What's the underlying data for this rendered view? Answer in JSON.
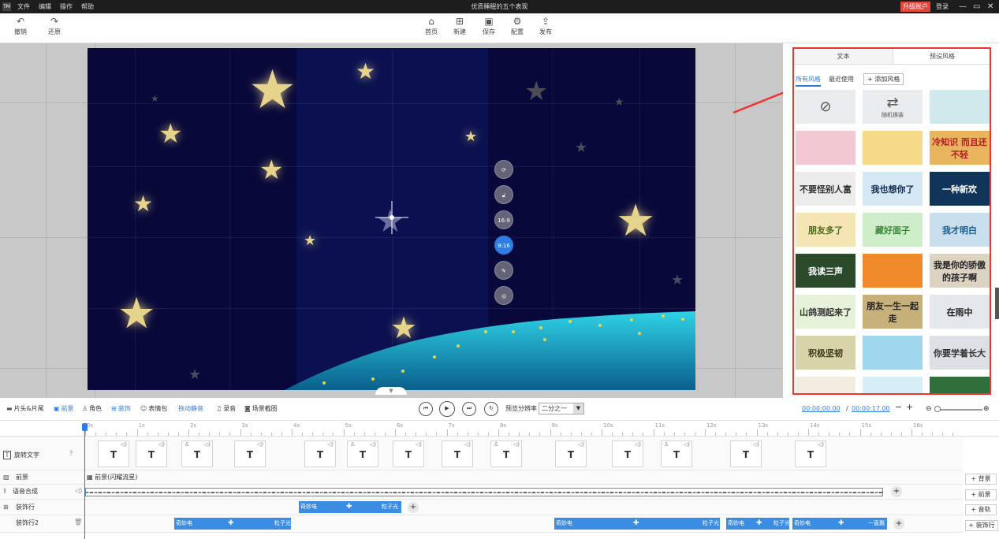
{
  "window": {
    "logo": "TM",
    "menu": [
      "文件",
      "编辑",
      "操作",
      "帮助"
    ],
    "title": "优质睡眠的五个表现",
    "upgrade": "升级账户",
    "login": "登录",
    "controls": [
      "—",
      "▭",
      "✕"
    ]
  },
  "toolbar": {
    "undo": "撤销",
    "redo": "还原",
    "home": "首页",
    "new": "新建",
    "save": "保存",
    "config": "配置",
    "publish": "发布"
  },
  "canvas_controls": [
    "16:9",
    "9:16"
  ],
  "panel": {
    "tabs": [
      "文本",
      "预设风格"
    ],
    "subtabs": [
      "所有风格",
      "最近使用"
    ],
    "add_style": "+ 添加风格",
    "random_label": "随机换装",
    "tiles": [
      {
        "text": "",
        "bg": "#e9ecef",
        "color": "#333"
      },
      {
        "text": "随机换装",
        "bg": "#e9ecef",
        "color": "#333"
      },
      {
        "text": "",
        "bg": "#cfe9ec",
        "color": "#333"
      },
      {
        "text": "",
        "bg": "#f2c9d3",
        "color": "#333"
      },
      {
        "text": "",
        "bg": "#f7d98a",
        "color": "#8a4a00"
      },
      {
        "text": "冷知识 而且还不轻",
        "bg": "#e8b45e",
        "color": "#b0201c"
      },
      {
        "text": "不要怪别人富",
        "bg": "#ececec",
        "color": "#333"
      },
      {
        "text": "我也想你了",
        "bg": "#d5e8f4",
        "color": "#0f2a4d"
      },
      {
        "text": "一种新欢",
        "bg": "#10345a",
        "color": "#fff"
      },
      {
        "text": "朋友多了",
        "bg": "#f5e4b4",
        "color": "#4d6a1a"
      },
      {
        "text": "藏好面子",
        "bg": "#cdeec9",
        "color": "#3a8a3a"
      },
      {
        "text": "我才明白",
        "bg": "#c9dfee",
        "color": "#1a5c8c"
      },
      {
        "text": "我读三声",
        "bg": "#2b4a2a",
        "color": "#fff"
      },
      {
        "text": "",
        "bg": "#f08a2a",
        "color": "#fff"
      },
      {
        "text": "我是你的骄傲的孩子啊",
        "bg": "#dcd3c2",
        "color": "#222"
      },
      {
        "text": "山鸽测起来了",
        "bg": "#e6f1d9",
        "color": "#333"
      },
      {
        "text": "朋友一生一起走",
        "bg": "#c8b07a",
        "color": "#222"
      },
      {
        "text": "在雨中",
        "bg": "#e4e8ec",
        "color": "#222"
      },
      {
        "text": "积极坚韧",
        "bg": "#d6d4a8",
        "color": "#3a3a1a"
      },
      {
        "text": "",
        "bg": "#9fd6ee",
        "color": "#333"
      },
      {
        "text": "你要学着长大",
        "bg": "#dde1e6",
        "color": "#333"
      },
      {
        "text": "",
        "bg": "#f3ece0",
        "color": "#333"
      },
      {
        "text": "",
        "bg": "#d8eef6",
        "color": "#333"
      },
      {
        "text": "",
        "bg": "#2e6e3a",
        "color": "#fff"
      }
    ]
  },
  "timeline_toolbar": {
    "items": [
      "片头&片尾",
      "前景",
      "角色",
      "装饰",
      "表情包",
      "拖动静音",
      "录音",
      "场景截图"
    ],
    "ratio_label": "预览分辨率",
    "ratio_value": "二分之一",
    "time_current": "00:00:00.00",
    "time_sep": "/",
    "time_total": "00:00:17.00"
  },
  "ruler": [
    "0s",
    "1s",
    "2s",
    "3s",
    "4s",
    "5s",
    "6s",
    "7s",
    "8s",
    "9s",
    "10s",
    "11s",
    "12s",
    "13s",
    "14s",
    "15s",
    "16s"
  ],
  "tracks": {
    "rotate_text": "旋转文字",
    "foreground": "前景",
    "foreground_clip": "前景(闪耀流星)",
    "voice": "语音合成",
    "decor1": "装饰行",
    "decor2": "装饰行2",
    "clip_a": "奇妙电",
    "clip_b": "粒子光",
    "clip_c": "奇妙电",
    "clip_d": "粒子光",
    "clip_e": "奇妙电",
    "clip_f": "粒子光",
    "clip_g": "奇妙电",
    "clip_h": "一直飘",
    "clip_i": "奇妙电",
    "clip_j": "粒子光"
  },
  "side_buttons": [
    "+ 背景",
    "+ 前景",
    "+ 音轨",
    "+ 装饰行"
  ]
}
